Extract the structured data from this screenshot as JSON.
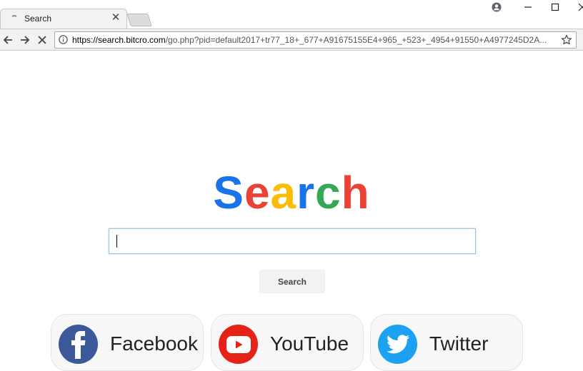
{
  "browser": {
    "tab_title": "Search",
    "url_host": "https://search.bitcro.com",
    "url_path": "/go.php?pid=default2017+tr77_18+_677+A91675155E4+965_+523+_4954+91550+A4977245D2A..."
  },
  "logo": {
    "letters": [
      {
        "char": "S",
        "color": "#1a73e8"
      },
      {
        "char": "e",
        "color": "#ea4335"
      },
      {
        "char": "a",
        "color": "#fbbc05"
      },
      {
        "char": "r",
        "color": "#1a73e8"
      },
      {
        "char": "c",
        "color": "#34a853"
      },
      {
        "char": "h",
        "color": "#ea4335"
      }
    ]
  },
  "search": {
    "input_value": "",
    "button_label": "Search"
  },
  "quick_links": [
    {
      "label": "Facebook",
      "icon": "facebook-icon",
      "color": "#3b5998"
    },
    {
      "label": "YouTube",
      "icon": "youtube-icon",
      "color": "#e62117"
    },
    {
      "label": "Twitter",
      "icon": "twitter-icon",
      "color": "#1da1f2"
    }
  ]
}
